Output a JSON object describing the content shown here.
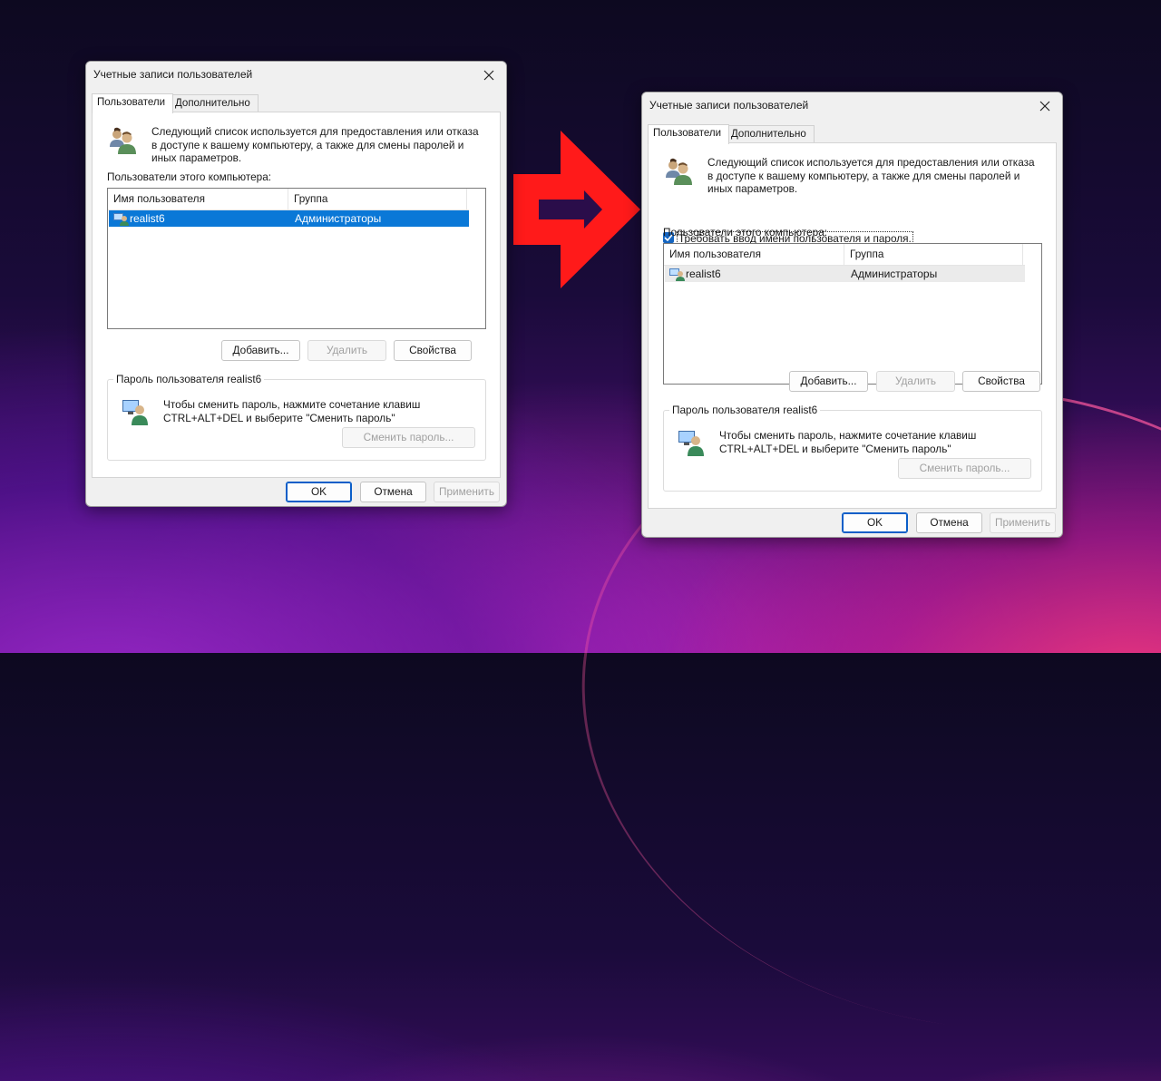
{
  "dialog1": {
    "title": "Учетные записи пользователей",
    "tabs": [
      "Пользователи",
      "Дополнительно"
    ],
    "intro_lines": [
      "Следующий список используется для предоставления или отказа",
      "в доступе к вашему компьютеру, а также для смены паролей и",
      "иных параметров."
    ],
    "users_label": "Пользователи этого компьютера:",
    "columns": [
      "Имя пользователя",
      "Группа"
    ],
    "rows": [
      {
        "name": "realist6",
        "group": "Администраторы"
      }
    ],
    "buttons": {
      "add": "Добавить...",
      "remove": "Удалить",
      "properties": "Свойства"
    },
    "password_group": {
      "title": "Пароль пользователя realist6",
      "lines": [
        "Чтобы сменить пароль, нажмите сочетание клавиш",
        "CTRL+ALT+DEL и выберите \"Сменить пароль\""
      ],
      "change_button": "Сменить пароль..."
    },
    "footer": {
      "ok": "OK",
      "cancel": "Отмена",
      "apply": "Применить"
    }
  },
  "dialog2": {
    "title": "Учетные записи пользователей",
    "tabs": [
      "Пользователи",
      "Дополнительно"
    ],
    "intro_lines": [
      "Следующий список используется для предоставления или отказа",
      "в доступе к вашему компьютеру, а также для смены паролей и",
      "иных параметров."
    ],
    "require_login_checkbox": {
      "label": "Требовать ввод имени пользователя и пароля.",
      "checked": true
    },
    "users_label": "Пользователи этого компьютера:",
    "columns": [
      "Имя пользователя",
      "Группа"
    ],
    "rows": [
      {
        "name": "realist6",
        "group": "Администраторы"
      }
    ],
    "buttons": {
      "add": "Добавить...",
      "remove": "Удалить",
      "properties": "Свойства"
    },
    "password_group": {
      "title": "Пароль пользователя realist6",
      "lines": [
        "Чтобы сменить пароль, нажмите сочетание клавиш",
        "CTRL+ALT+DEL и выберите \"Сменить пароль\""
      ],
      "change_button": "Сменить пароль..."
    },
    "footer": {
      "ok": "OK",
      "cancel": "Отмена",
      "apply": "Применить"
    }
  },
  "icons": {
    "users": "users-group-icon",
    "user_row": "user-account-icon",
    "password": "user-password-icon",
    "arrow": "red-arrow-right-icon",
    "close": "close-icon"
  },
  "colors": {
    "arrow": "#ff1a1a",
    "selection": "#0a78d7",
    "checkbox": "#1565c0",
    "default_button_border": "#0a5ec8"
  }
}
